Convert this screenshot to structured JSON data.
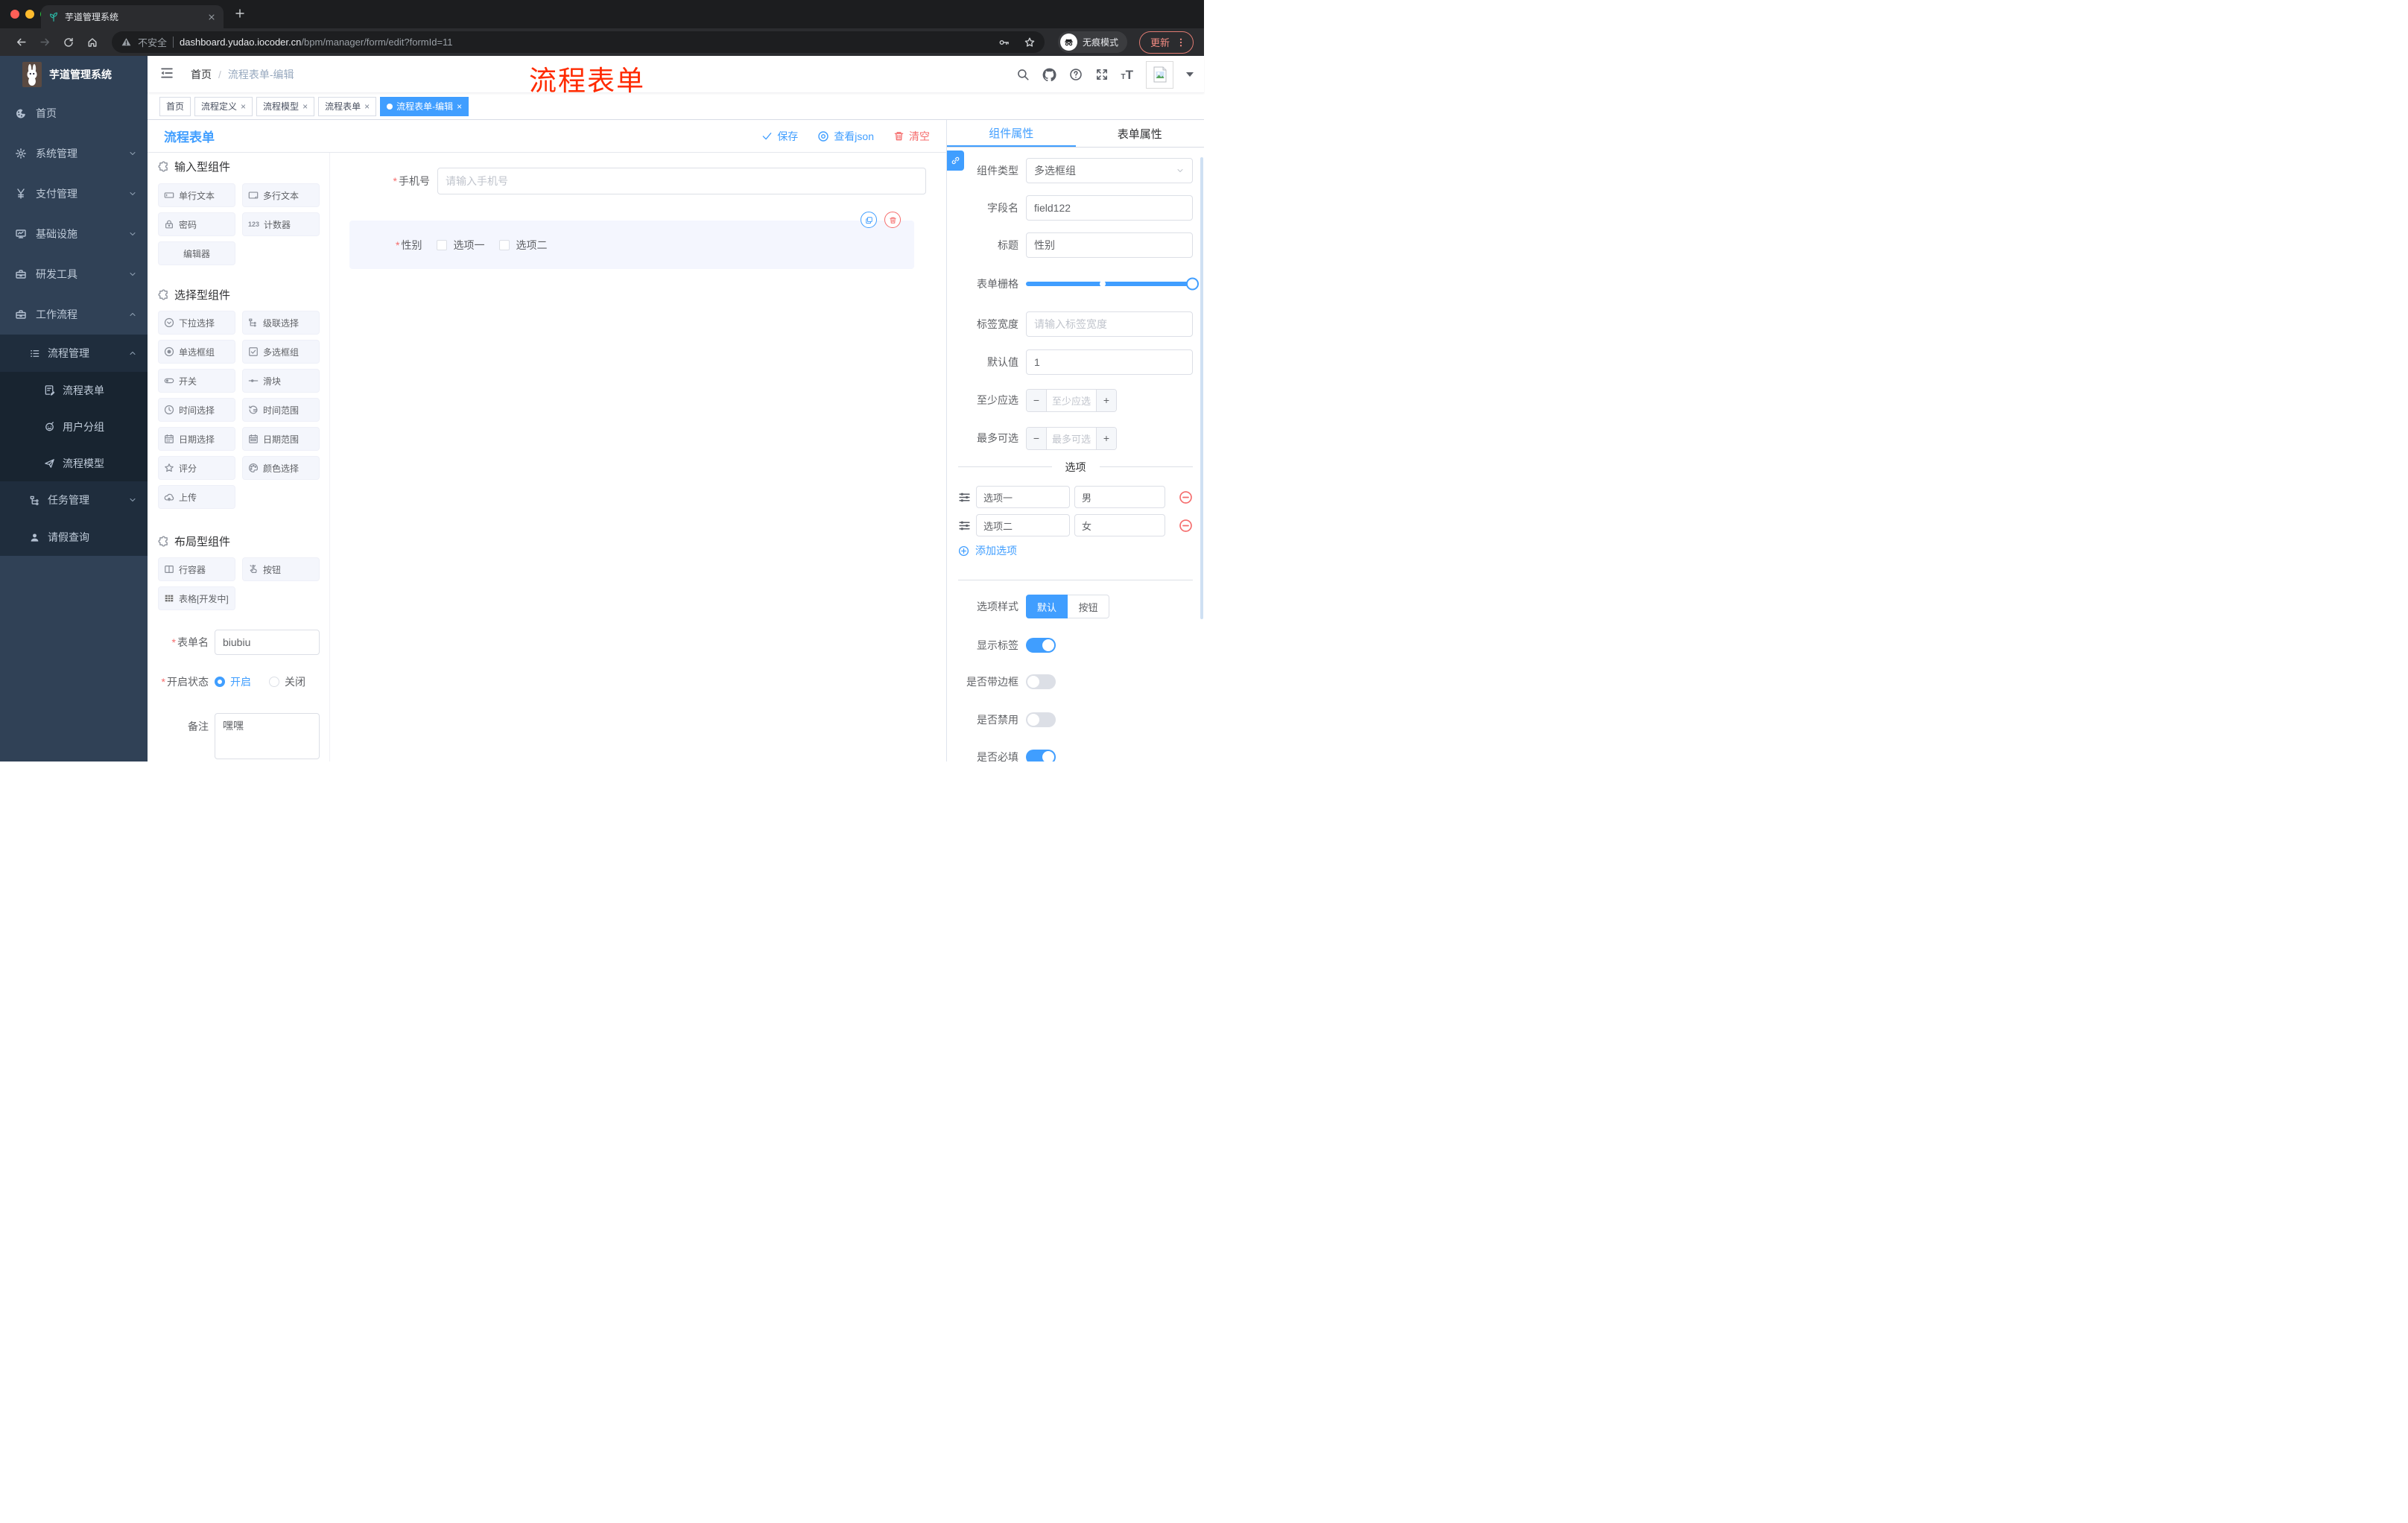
{
  "required_mark": "*",
  "glyphs": {
    "close": "×",
    "t_small": "T",
    "t_large": "T",
    "slash": "/"
  },
  "browser": {
    "tab_title": "芋道管理系统",
    "security_label": "不安全",
    "url_host": "dashboard.yudao.iocoder.cn",
    "url_path": "/bpm/manager/form/edit?formId=11",
    "incognito_label": "无痕模式",
    "update_label": "更新"
  },
  "header": {
    "logo_title": "芋道管理系统",
    "breadcrumb_home": "首页",
    "breadcrumb_current": "流程表单-编辑",
    "watermark": "流程表单"
  },
  "tags": [
    {
      "label": "首页"
    },
    {
      "label": "流程定义"
    },
    {
      "label": "流程模型"
    },
    {
      "label": "流程表单"
    },
    {
      "label": "流程表单-编辑"
    }
  ],
  "sidebar": {
    "items": [
      {
        "label": "首页"
      },
      {
        "label": "系统管理"
      },
      {
        "label": "支付管理"
      },
      {
        "label": "基础设施"
      },
      {
        "label": "研发工具"
      },
      {
        "label": "工作流程"
      }
    ],
    "submenu": {
      "process_mgmt": "流程管理",
      "children": [
        {
          "label": "流程表单"
        },
        {
          "label": "用户分组"
        },
        {
          "label": "流程模型"
        }
      ],
      "task_mgmt": "任务管理",
      "leave_query": "请假查询"
    }
  },
  "toolbar": {
    "title": "流程表单",
    "save": "保存",
    "view_json": "查看json",
    "clear": "清空"
  },
  "components_panel": {
    "sections": [
      {
        "title": "输入型组件",
        "items": [
          "单行文本",
          "多行文本",
          "密码",
          "计数器",
          "编辑器"
        ]
      },
      {
        "title": "选择型组件",
        "items": [
          "下拉选择",
          "级联选择",
          "单选框组",
          "多选框组",
          "开关",
          "滑块",
          "时间选择",
          "时间范围",
          "日期选择",
          "日期范围",
          "评分",
          "颜色选择",
          "上传"
        ]
      },
      {
        "title": "布局型组件",
        "items": [
          "行容器",
          "按钮",
          "表格[开发中]"
        ]
      }
    ],
    "form_meta": {
      "name_label": "表单名",
      "name_value": "biubiu",
      "status_label": "开启状态",
      "status_on": "开启",
      "status_off": "关闭",
      "remark_label": "备注",
      "remark_value": "嘿嘿"
    }
  },
  "canvas": {
    "phone": {
      "label": "手机号",
      "placeholder": "请输入手机号"
    },
    "gender": {
      "label": "性别",
      "option1": "选项一",
      "option2": "选项二"
    }
  },
  "properties": {
    "tab_component": "组件属性",
    "tab_form": "表单属性",
    "component_type_label": "组件类型",
    "component_type_value": "多选框组",
    "field_name_label": "字段名",
    "field_name_value": "field122",
    "title_label": "标题",
    "title_value": "性别",
    "grid_label": "表单栅格",
    "label_width_label": "标签宽度",
    "label_width_placeholder": "请输入标签宽度",
    "default_label": "默认值",
    "default_value": "1",
    "min_label": "至少应选",
    "min_placeholder": "至少应选",
    "max_label": "最多可选",
    "max_placeholder": "最多可选",
    "minus": "−",
    "plus": "+",
    "options_title": "选项",
    "options": [
      {
        "label": "选项一",
        "value": "男"
      },
      {
        "label": "选项二",
        "value": "女"
      }
    ],
    "add_option": "添加选项",
    "style_label": "选项样式",
    "style_default": "默认",
    "style_button": "按钮",
    "switch_show_label": "显示标签",
    "switch_border": "是否带边框",
    "switch_disabled": "是否禁用",
    "switch_required": "是否必填"
  },
  "colors": {
    "accent": "#409eff",
    "danger": "#f56c6c",
    "watermark": "#ff2a00",
    "sidebar_bg": "#304156",
    "submenu_bg": "#1f2d3d"
  }
}
